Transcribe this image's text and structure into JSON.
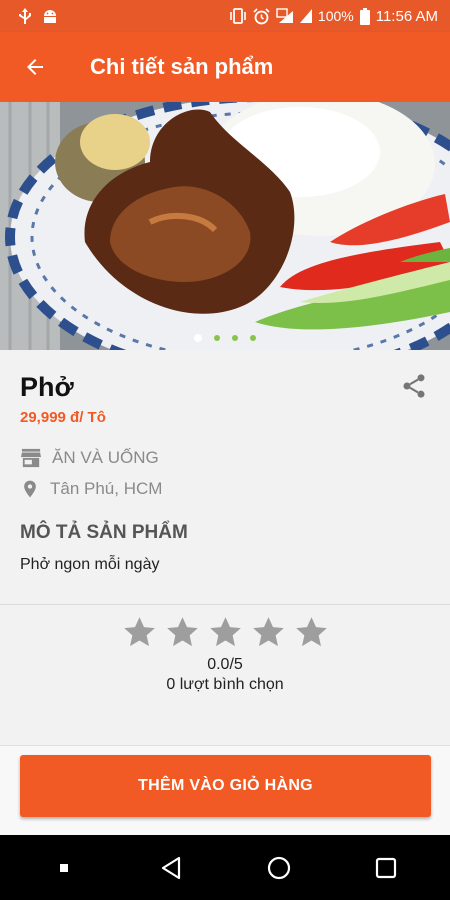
{
  "status_bar": {
    "battery_percent": "100%",
    "time": "11:56 AM"
  },
  "app_bar": {
    "title": "Chi tiết sản phẩm"
  },
  "gallery": {
    "image_count": 4,
    "active_index": 0
  },
  "product": {
    "name": "Phở",
    "price": "29,999 đ/ Tô",
    "category": "ĂN VÀ UỐNG",
    "location": "Tân Phú, HCM",
    "description_title": "MÔ TẢ SẢN PHẨM",
    "description": "Phở ngon mỗi ngày"
  },
  "rating": {
    "stars_total": 5,
    "stars_filled": 0,
    "score": "0.0/5",
    "votes": "0 lượt bình chọn"
  },
  "footer": {
    "add_to_cart_label": "THÊM VÀO GIỎ HÀNG"
  },
  "colors": {
    "brand": "#f15a24",
    "status_bar": "#e8592a",
    "star": "#9e9e9e",
    "meta_text": "#8a8a8a"
  }
}
